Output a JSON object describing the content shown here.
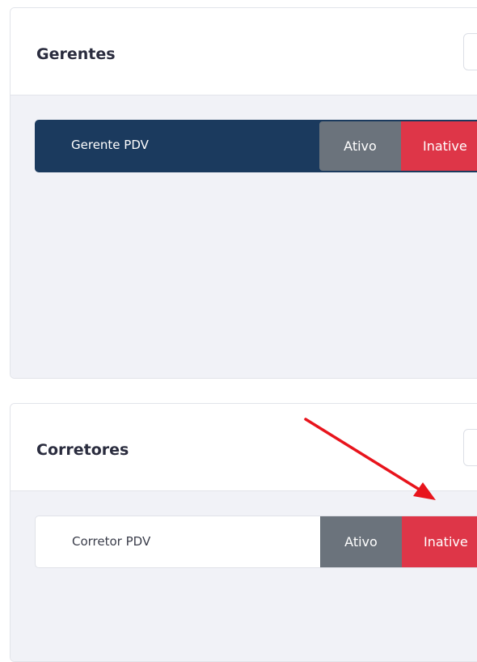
{
  "sections": [
    {
      "title": "Gerentes",
      "row": {
        "label": "Gerente PDV",
        "ativo_label": "Ativo",
        "inativo_label": "Inative"
      }
    },
    {
      "title": "Corretores",
      "row": {
        "label": "Corretor PDV",
        "ativo_label": "Ativo",
        "inativo_label": "Inative"
      }
    }
  ],
  "colors": {
    "row_selected_bg": "#1b3a5e",
    "ativo_button": "#6b737c",
    "inativo_button": "#de3648",
    "annotation_arrow": "#e8141c"
  }
}
